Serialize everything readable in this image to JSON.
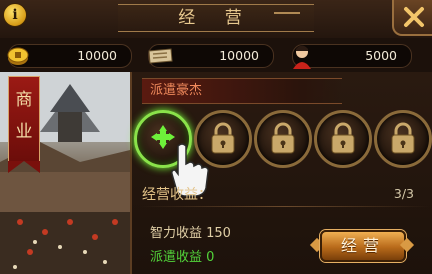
{
  "window": {
    "title": "经 营"
  },
  "resources": [
    {
      "icon": "gold-coin-icon",
      "value": "10000"
    },
    {
      "icon": "provisions-sack-icon",
      "value": "10000"
    },
    {
      "icon": "soldier-icon",
      "value": "5000"
    }
  ],
  "scene": {
    "banner_text": [
      "商",
      "业"
    ]
  },
  "dispatch": {
    "heading": "派遣豪杰",
    "slots": [
      {
        "state": "active",
        "icon": "add-move-icon"
      },
      {
        "state": "locked",
        "icon": "padlock-icon"
      },
      {
        "state": "locked",
        "icon": "padlock-icon"
      },
      {
        "state": "locked",
        "icon": "padlock-icon"
      },
      {
        "state": "locked",
        "icon": "padlock-icon"
      }
    ]
  },
  "income": {
    "label": "经营收益：",
    "count": "3/3",
    "intel_income": "智力收益 150",
    "dispatch_income": "派遣收益 0"
  },
  "actions": {
    "run_label": "经营"
  },
  "colors": {
    "accent_gold": "#e8c98f",
    "dispatch_green": "#52d33a",
    "heading_red": "#f08a5c"
  }
}
